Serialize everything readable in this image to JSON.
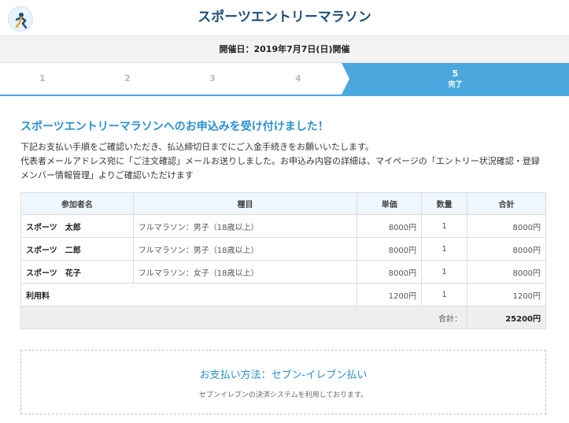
{
  "header": {
    "title": "スポーツエントリーマラソン"
  },
  "event": {
    "date_text": "開催日：2019年7月7日(日)開催"
  },
  "steps": [
    {
      "number": "1"
    },
    {
      "number": "2"
    },
    {
      "number": "3"
    },
    {
      "number": "4"
    },
    {
      "number": "5",
      "label": "完了"
    }
  ],
  "message": {
    "title": "スポーツエントリーマラソンへのお申込みを受け付けました！",
    "line1": "下記お支払い手順をご確認いただき、払込締切日までにご入金手続きをお願いいたします。",
    "line2": "代表者メールアドレス宛に「ご注文確認」メールお送りしました。お申込み内容の詳細は、マイページの「エントリー状況確認・登録メンバー情報管理」よりご確認いただけます"
  },
  "table": {
    "headers": [
      "参加者名",
      "種目",
      "単価",
      "数量",
      "合計"
    ],
    "rows": [
      {
        "name": "スポーツ　太郎",
        "event": "フルマラソン：男子（18歳以上）",
        "price": "8000円",
        "qty": "1",
        "total": "8000円"
      },
      {
        "name": "スポーツ　二郎",
        "event": "フルマラソン：男子（18歳以上）",
        "price": "8000円",
        "qty": "1",
        "total": "8000円"
      },
      {
        "name": "スポーツ　花子",
        "event": "フルマラソン：女子（18歳以上）",
        "price": "8000円",
        "qty": "1",
        "total": "8000円"
      }
    ],
    "fee": {
      "label": "利用料",
      "price": "1200円",
      "qty": "1",
      "total": "1200円"
    },
    "sum_label": "合計：",
    "sum_value": "25200円"
  },
  "payment": {
    "title": "お支払い方法：セブン-イレブン払い",
    "description": "セブンイレブンの決済システムを利用しております。"
  },
  "colors": {
    "accent": "#4aa8df",
    "title": "#1f4e79",
    "link": "#2a8fcf"
  },
  "icons": {
    "logo": "runner-logo-icon"
  }
}
